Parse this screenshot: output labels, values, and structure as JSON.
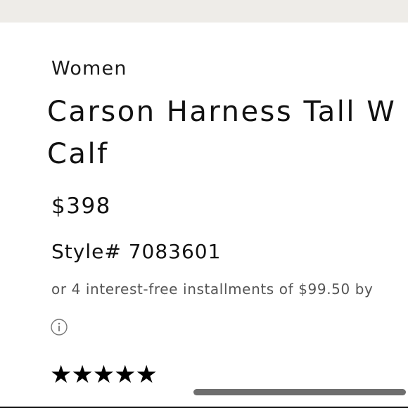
{
  "product": {
    "category": "Women",
    "title_line1": "Carson Harness Tall W",
    "title_line2": "Calf",
    "price": "$398",
    "style_number": "Style# 7083601",
    "installments_text": "or 4 interest-free installments of $99.50 by",
    "info_icon": "info-circle-icon",
    "rating": {
      "stars_text": "★★★★★",
      "value": 5,
      "max": 5
    }
  },
  "ui": {
    "scrollbar": {
      "orientation": "horizontal"
    }
  },
  "colors": {
    "top_bar": "#eeece8",
    "text_primary": "#111111",
    "text_secondary": "#555555",
    "scrollbar_thumb": "#6e6e6e"
  }
}
